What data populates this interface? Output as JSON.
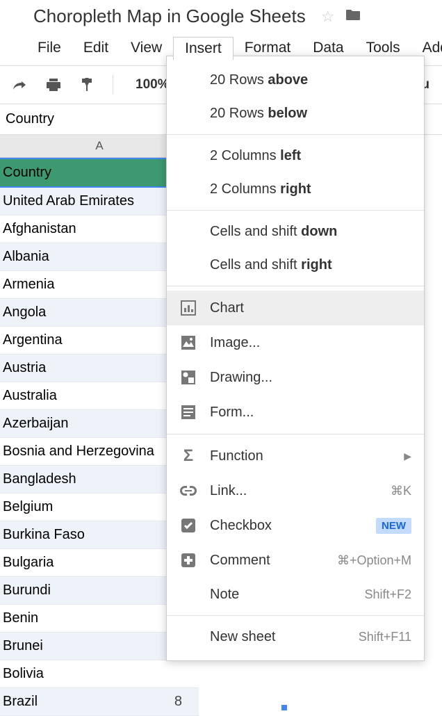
{
  "header": {
    "title": "Choropleth Map in Google Sheets"
  },
  "menubar": {
    "items": [
      {
        "label": "File",
        "active": false
      },
      {
        "label": "Edit",
        "active": false
      },
      {
        "label": "View",
        "active": false
      },
      {
        "label": "Insert",
        "active": true
      },
      {
        "label": "Format",
        "active": false
      },
      {
        "label": "Data",
        "active": false
      },
      {
        "label": "Tools",
        "active": false
      },
      {
        "label": "Add",
        "active": false
      }
    ]
  },
  "toolbar": {
    "zoom": "100%",
    "right_hint": "Qu"
  },
  "formula_bar": {
    "value": "Country"
  },
  "columns": {
    "A": "A"
  },
  "rows": [
    "Country",
    "United Arab Emirates",
    "Afghanistan",
    "Albania",
    "Armenia",
    "Angola",
    "Argentina",
    "Austria",
    "Australia",
    "Azerbaijan",
    "Bosnia and Herzegovina",
    "Bangladesh",
    "Belgium",
    "Burkina Faso",
    "Bulgaria",
    "Burundi",
    "Benin",
    "Brunei",
    "Bolivia",
    "Brazil"
  ],
  "brazil_value": "8",
  "dropdown": {
    "sections": [
      [
        {
          "label_pre": "20 Rows ",
          "label_bold": "above"
        },
        {
          "label_pre": "20 Rows ",
          "label_bold": "below"
        }
      ],
      [
        {
          "label_pre": "2 Columns ",
          "label_bold": "left"
        },
        {
          "label_pre": "2 Columns ",
          "label_bold": "right"
        }
      ],
      [
        {
          "label_pre": "Cells and shift ",
          "label_bold": "down"
        },
        {
          "label_pre": "Cells and shift ",
          "label_bold": "right"
        }
      ],
      [
        {
          "icon": "chart",
          "label": "Chart",
          "hovered": true
        },
        {
          "icon": "image",
          "label": "Image..."
        },
        {
          "icon": "drawing",
          "label": "Drawing..."
        },
        {
          "icon": "form",
          "label": "Form..."
        }
      ],
      [
        {
          "icon": "function",
          "label": "Function",
          "submenu": true
        },
        {
          "icon": "link",
          "label": "Link...",
          "shortcut": "⌘K"
        },
        {
          "icon": "checkbox",
          "label": "Checkbox",
          "badge": "NEW"
        },
        {
          "icon": "comment",
          "label": "Comment",
          "shortcut": "⌘+Option+M"
        },
        {
          "label": "Note",
          "shortcut": "Shift+F2",
          "no_icon": true
        }
      ],
      [
        {
          "label": "New sheet",
          "shortcut": "Shift+F11",
          "no_icon": true
        }
      ]
    ]
  }
}
